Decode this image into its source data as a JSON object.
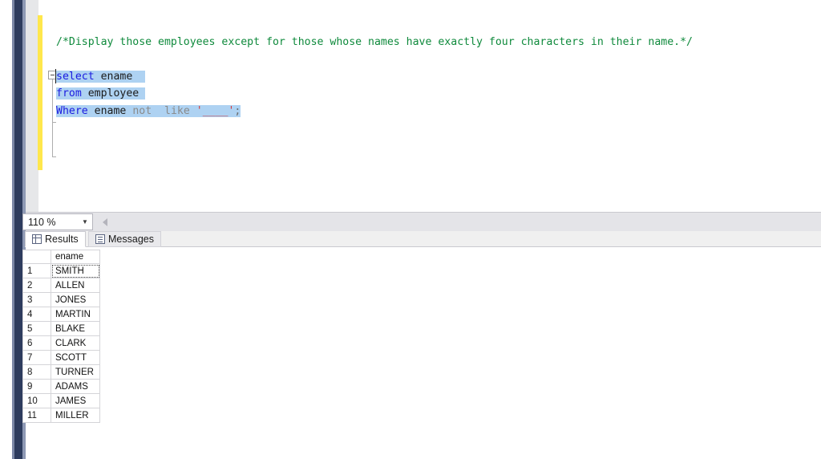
{
  "editor": {
    "comment": "/*Display those employees except for those whose names have exactly four characters in their name.*/",
    "line_select": {
      "keyword": "select",
      "space": " ",
      "identifier": "ename"
    },
    "line_from": {
      "keyword": "from",
      "space": " ",
      "identifier": "employee"
    },
    "line_where": {
      "keyword": "Where",
      "identifier": "ename",
      "not": "not",
      "like": "like",
      "string": "'____'",
      "semicolon": ";"
    },
    "fold_state": "expanded",
    "colors": {
      "comment": "#0f8a3c",
      "keyword": "#1a1ae0",
      "string": "#d63b3b",
      "selection": "#aed2f2",
      "change_bar": "#ffe74c"
    }
  },
  "zoom_bar": {
    "level": "110 %",
    "dropdown_icon": "chevron-down-icon"
  },
  "results": {
    "tabs": [
      {
        "label": "Results",
        "icon": "grid-icon",
        "active": true
      },
      {
        "label": "Messages",
        "icon": "message-icon",
        "active": false
      }
    ],
    "grid": {
      "rownum_header": "",
      "columns": [
        "ename"
      ],
      "rows": [
        {
          "n": "1",
          "ename": "SMITH"
        },
        {
          "n": "2",
          "ename": "ALLEN"
        },
        {
          "n": "3",
          "ename": "JONES"
        },
        {
          "n": "4",
          "ename": "MARTIN"
        },
        {
          "n": "5",
          "ename": "BLAKE"
        },
        {
          "n": "6",
          "ename": "CLARK"
        },
        {
          "n": "7",
          "ename": "SCOTT"
        },
        {
          "n": "8",
          "ename": "TURNER"
        },
        {
          "n": "9",
          "ename": "ADAMS"
        },
        {
          "n": "10",
          "ename": "JAMES"
        },
        {
          "n": "11",
          "ename": "MILLER"
        }
      ],
      "focused_cell": "SMITH"
    }
  }
}
